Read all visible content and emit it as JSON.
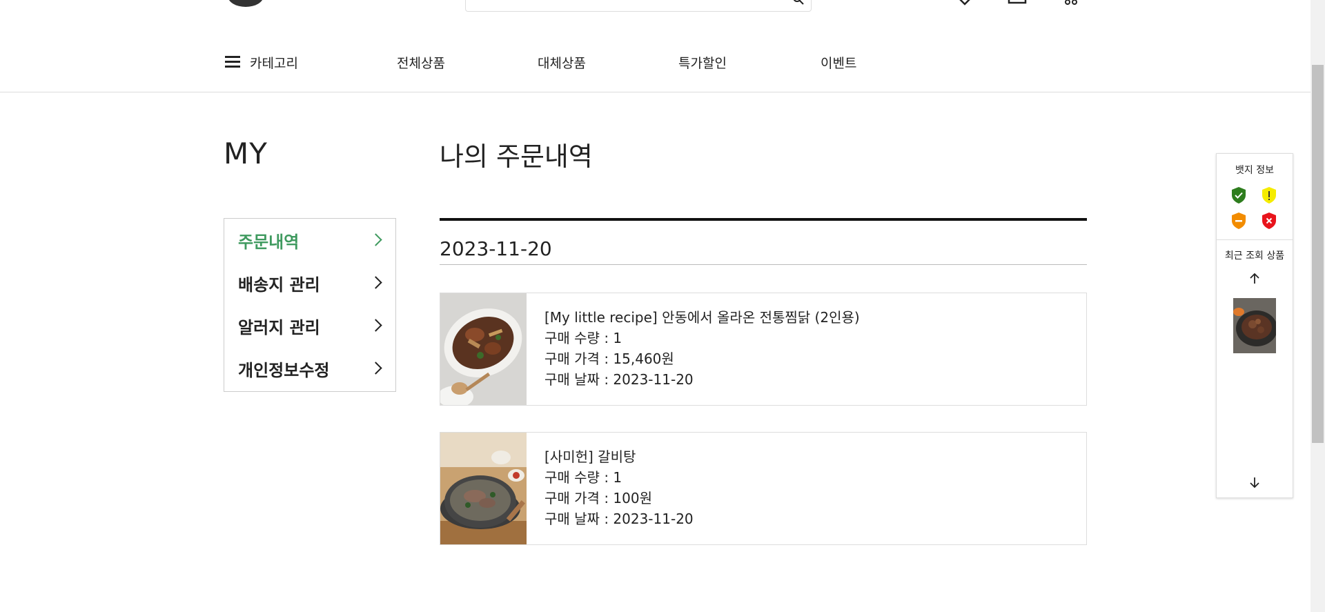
{
  "nav": {
    "items": [
      {
        "label": "카테고리"
      },
      {
        "label": "전체상품"
      },
      {
        "label": "대체상품"
      },
      {
        "label": "특가할인"
      },
      {
        "label": "이벤트"
      }
    ]
  },
  "sidebar": {
    "title": "MY",
    "items": [
      {
        "label": "주문내역",
        "active": true
      },
      {
        "label": "배송지 관리",
        "active": false
      },
      {
        "label": "알러지 관리",
        "active": false
      },
      {
        "label": "개인정보수정",
        "active": false
      }
    ]
  },
  "main": {
    "title": "나의 주문내역",
    "groups": [
      {
        "date": "2023-11-20",
        "orders": [
          {
            "name": "[My little recipe] 안동에서 올라온 전통찜닭 (2인용)",
            "quantity": "구매 수량 : 1",
            "price": "구매 가격 : 15,460원",
            "date": "구매 날짜 : 2023-11-20"
          },
          {
            "name": "[사미헌] 갈비탕",
            "quantity": "구매 수량 : 1",
            "price": "구매 가격 : 100원",
            "date": "구매 날짜 : 2023-11-20"
          }
        ]
      }
    ]
  },
  "badge_panel": {
    "title": "뱃지 정보",
    "badges": [
      {
        "icon": "check-shield-icon",
        "color": "#2e7d1e"
      },
      {
        "icon": "warning-shield-icon",
        "color": "#f5ec00"
      },
      {
        "icon": "minus-shield-icon",
        "color": "#f28c00"
      },
      {
        "icon": "x-shield-icon",
        "color": "#e8141c"
      }
    ],
    "recent_title": "최근 조회 상품"
  },
  "colors": {
    "accent": "#3f9a5f"
  }
}
